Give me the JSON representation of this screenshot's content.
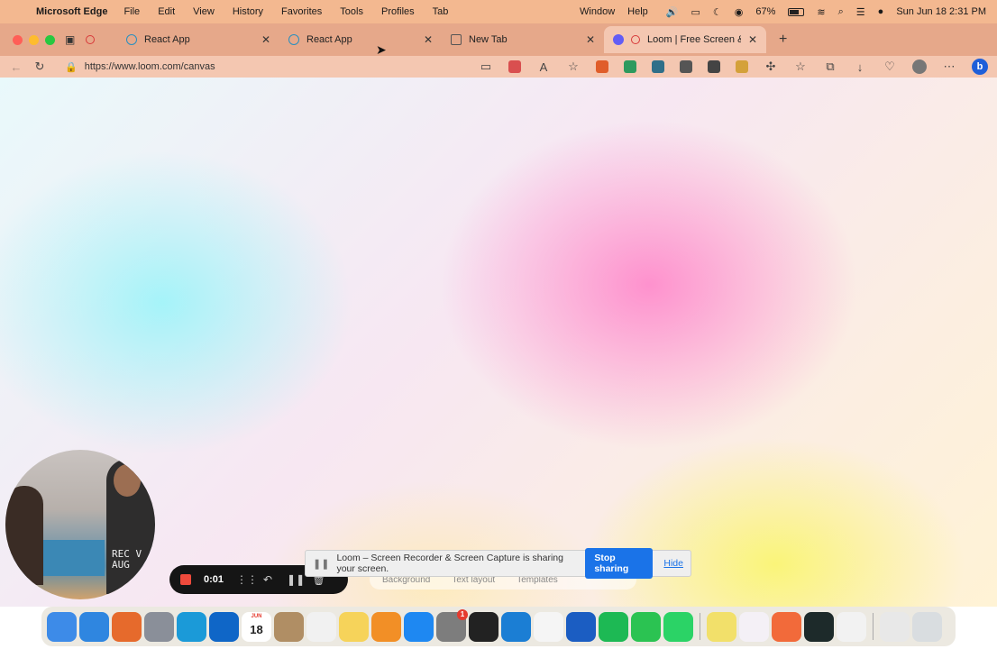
{
  "menubar": {
    "app_name": "Microsoft Edge",
    "menus": [
      "File",
      "Edit",
      "View",
      "History",
      "Favorites",
      "Tools",
      "Profiles",
      "Tab",
      "Window",
      "Help"
    ],
    "battery": "67%",
    "battery_level": 0.67,
    "datetime": "Sun Jun 18  2:31 PM"
  },
  "tabs": [
    {
      "title": "React App",
      "favicon": "react-icon",
      "recording": true,
      "active": false
    },
    {
      "title": "React App",
      "favicon": "react-icon",
      "recording": false,
      "active": false
    },
    {
      "title": "New Tab",
      "favicon": "new-tab-icon",
      "recording": false,
      "active": false
    },
    {
      "title": "Loom | Free Screen & Vid",
      "favicon": "loom-icon",
      "recording": true,
      "active": true
    }
  ],
  "address": {
    "url": "https://www.loom.com/canvas"
  },
  "recording": {
    "timer": "0:01"
  },
  "loom_toolbar": {
    "items": [
      "Background",
      "Text layout",
      "Templates"
    ]
  },
  "share_banner": {
    "message": "Loom – Screen Recorder & Screen Capture is sharing your screen.",
    "stop_label": "Stop sharing",
    "hide_label": "Hide"
  },
  "cam": {
    "shirt_text": "REC V\nAUG"
  },
  "dock": {
    "apps": [
      {
        "name": "finder",
        "color": "#3d8be8"
      },
      {
        "name": "safari",
        "color": "#2f86e0"
      },
      {
        "name": "firefox",
        "color": "#e66a2c"
      },
      {
        "name": "launchpad",
        "color": "#8a8f99"
      },
      {
        "name": "edge",
        "color": "#1b9ad8"
      },
      {
        "name": "outlook",
        "color": "#0f66c7"
      },
      {
        "name": "calendar",
        "color": "#ffffff",
        "month": "JUN",
        "day": "18"
      },
      {
        "name": "contacts",
        "color": "#b08e64"
      },
      {
        "name": "reminders",
        "color": "#f1f1f1"
      },
      {
        "name": "notes",
        "color": "#f6d35a"
      },
      {
        "name": "pages",
        "color": "#f28f26"
      },
      {
        "name": "app-store",
        "color": "#1e88f2"
      },
      {
        "name": "system-settings",
        "color": "#7d7d7d",
        "badge": "1"
      },
      {
        "name": "terminal",
        "color": "#222222"
      },
      {
        "name": "vscode",
        "color": "#1b7ed4"
      },
      {
        "name": "notion",
        "color": "#f5f5f5"
      },
      {
        "name": "word",
        "color": "#1b5dc2"
      },
      {
        "name": "spotify",
        "color": "#1db954"
      },
      {
        "name": "facetime",
        "color": "#2bc352"
      },
      {
        "name": "whatsapp",
        "color": "#2bd366"
      },
      {
        "name": "stickies",
        "color": "#f2e06a"
      },
      {
        "name": "slack",
        "color": "#f4f0f6"
      },
      {
        "name": "postman",
        "color": "#f26a3a"
      },
      {
        "name": "activity-monitor",
        "color": "#1d2a2a"
      },
      {
        "name": "textedit",
        "color": "#f2f2f2"
      },
      {
        "name": "downloads",
        "color": "#e8e8e8"
      },
      {
        "name": "trash",
        "color": "#d9dde0"
      }
    ]
  }
}
